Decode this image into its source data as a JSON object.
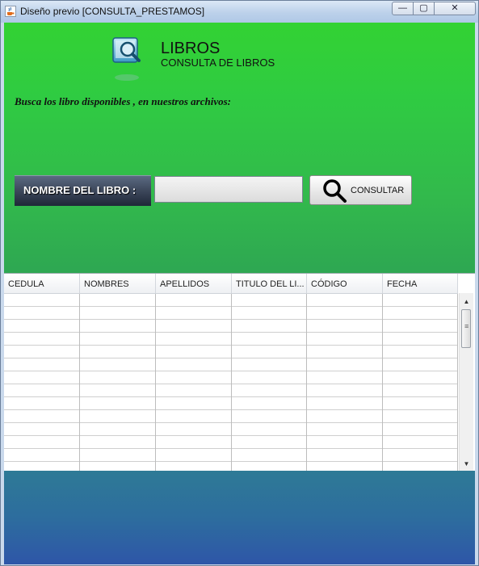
{
  "window": {
    "title": "Diseño previo [CONSULTA_PRESTAMOS]",
    "min_glyph": "—",
    "max_glyph": "▢",
    "close_glyph": "✕"
  },
  "header": {
    "title": "LIBROS",
    "subtitle": "CONSULTA DE LIBROS"
  },
  "description": "Busca los libro disponibles , en nuestros archivos:",
  "search": {
    "label": "NOMBRE DEL LIBRO :",
    "value": "",
    "button_label": "CONSULTAR"
  },
  "table": {
    "columns": [
      "CEDULA",
      "NOMBRES",
      "APELLIDOS",
      "TITULO DEL LI...",
      "CÓDIGO",
      "FECHA"
    ],
    "rows": []
  },
  "colors": {
    "green_top": "#33d233",
    "green_bottom": "#2ea752",
    "blue_bottom": "#2e56a8"
  },
  "icons": {
    "app": "java-cup-icon",
    "logo": "book-search-icon",
    "button": "magnifier-icon"
  }
}
